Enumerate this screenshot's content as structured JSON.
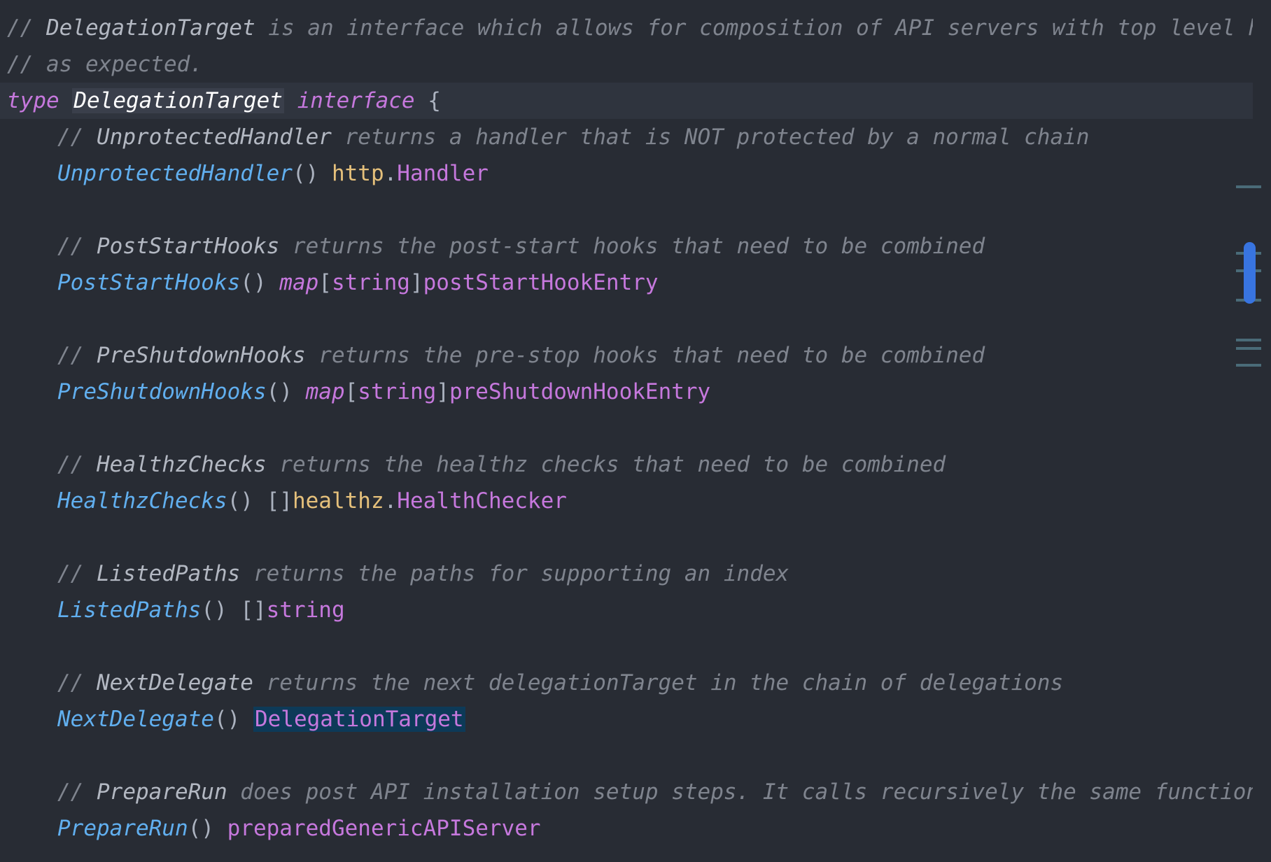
{
  "code": {
    "line1": {
      "slashes": "// ",
      "ident": "DelegationTarget",
      "rest": " is an interface which allows for composition of API servers with top level handling that works"
    },
    "line2": {
      "comment": "// as expected."
    },
    "line3": {
      "kw_type": "type",
      "name": "DelegationTarget",
      "kw_interface": "interface",
      "brace": " {"
    },
    "methods": [
      {
        "c_slashes": "// ",
        "c_ident": "UnprotectedHandler",
        "c_rest": " returns a handler that is NOT protected by a normal chain",
        "name": "UnprotectedHandler",
        "parens": "() ",
        "ret_pkg": "http",
        "dot": ".",
        "ret_type": "Handler"
      },
      {
        "c_slashes": "// ",
        "c_ident": "PostStartHooks",
        "c_rest": " returns the post-start hooks that need to be combined",
        "name": "PostStartHooks",
        "parens": "() ",
        "ret_kw": "map",
        "open": "[",
        "key": "string",
        "close": "]",
        "ret_type": "postStartHookEntry"
      },
      {
        "c_slashes": "// ",
        "c_ident": "PreShutdownHooks",
        "c_rest": " returns the pre-stop hooks that need to be combined",
        "name": "PreShutdownHooks",
        "parens": "() ",
        "ret_kw": "map",
        "open": "[",
        "key": "string",
        "close": "]",
        "ret_type": "preShutdownHookEntry"
      },
      {
        "c_slashes": "// ",
        "c_ident": "HealthzChecks",
        "c_rest": " returns the healthz checks that need to be combined",
        "name": "HealthzChecks",
        "parens": "() ",
        "slice": "[]",
        "ret_pkg": "healthz",
        "dot": ".",
        "ret_type": "HealthChecker"
      },
      {
        "c_slashes": "// ",
        "c_ident": "ListedPaths",
        "c_rest": " returns the paths for supporting an index",
        "name": "ListedPaths",
        "parens": "() ",
        "slice": "[]",
        "ret_type": "string"
      },
      {
        "c_slashes": "// ",
        "c_ident": "NextDelegate",
        "c_rest": " returns the next delegationTarget in the chain of delegations",
        "name": "NextDelegate",
        "parens": "() ",
        "ret_type": "DelegationTarget"
      },
      {
        "c_slashes": "// ",
        "c_ident": "PrepareRun",
        "c_rest": " does post API installation setup steps. It calls recursively the same function of",
        "name": "PrepareRun",
        "parens": "() ",
        "ret_type": "preparedGenericAPIServer"
      }
    ]
  },
  "colors": {
    "background": "#282c34",
    "current_line": "#2f343e",
    "comment": "#7f848e",
    "keyword": "#c678dd",
    "function": "#61afef",
    "package": "#e5c07b",
    "usage_highlight": "#0d3a58",
    "scroll_thumb": "#3874e0"
  }
}
